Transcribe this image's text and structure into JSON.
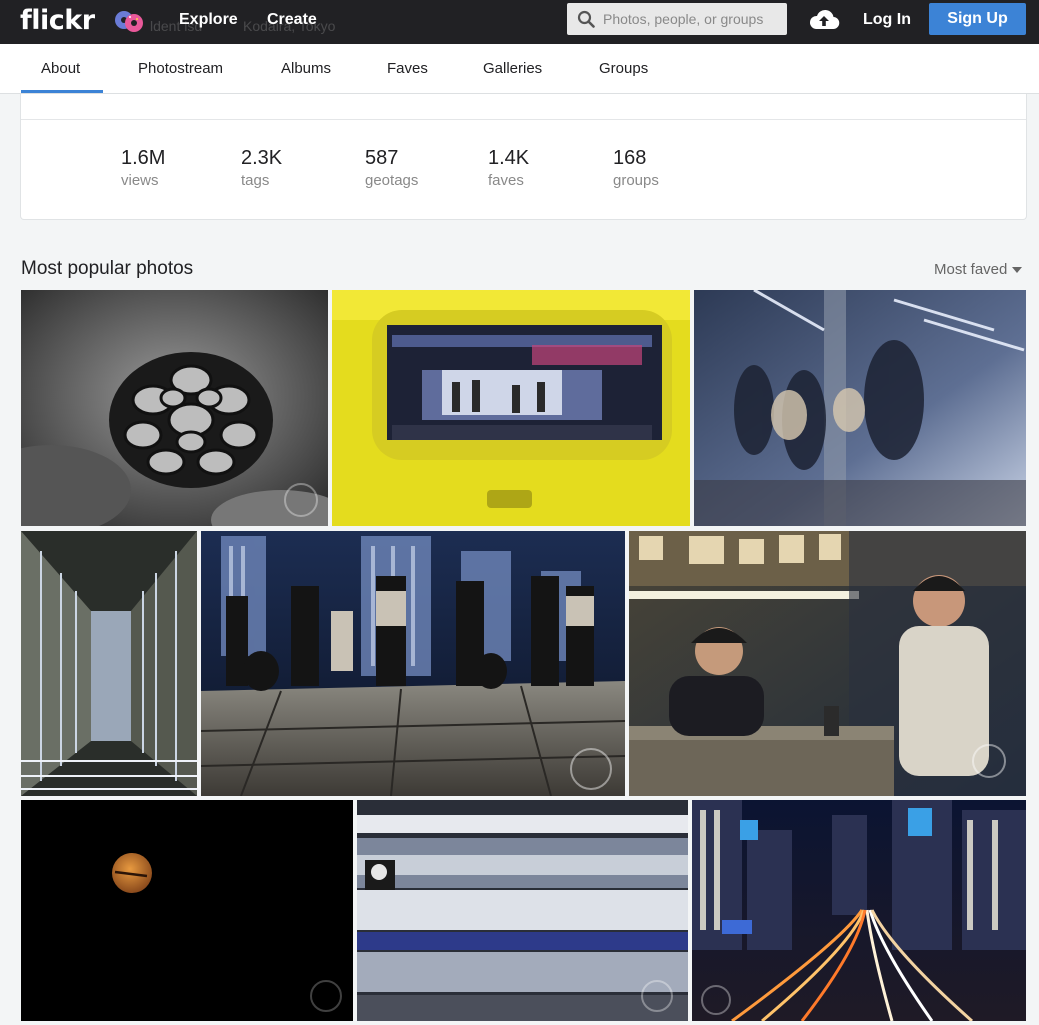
{
  "brand": {
    "logo_text": "flickr"
  },
  "topnav": {
    "ghost_left": "ldent lsd",
    "ghost_right": "Kodaira, Tokyo",
    "explore": "Explore",
    "create": "Create",
    "search_placeholder": "Photos, people, or groups",
    "login": "Log In",
    "signup": "Sign Up"
  },
  "tabs": [
    "About",
    "Photostream",
    "Albums",
    "Faves",
    "Galleries",
    "Groups"
  ],
  "active_tab": "About",
  "stats": [
    {
      "value": "1.6M",
      "label": "views"
    },
    {
      "value": "2.3K",
      "label": "tags"
    },
    {
      "value": "587",
      "label": "geotags"
    },
    {
      "value": "1.4K",
      "label": "faves"
    },
    {
      "value": "168",
      "label": "groups"
    }
  ],
  "popular": {
    "title": "Most popular photos",
    "sort_label": "Most faved"
  },
  "colors": {
    "accent": "#3c83d6",
    "nav_bg": "#212124"
  }
}
